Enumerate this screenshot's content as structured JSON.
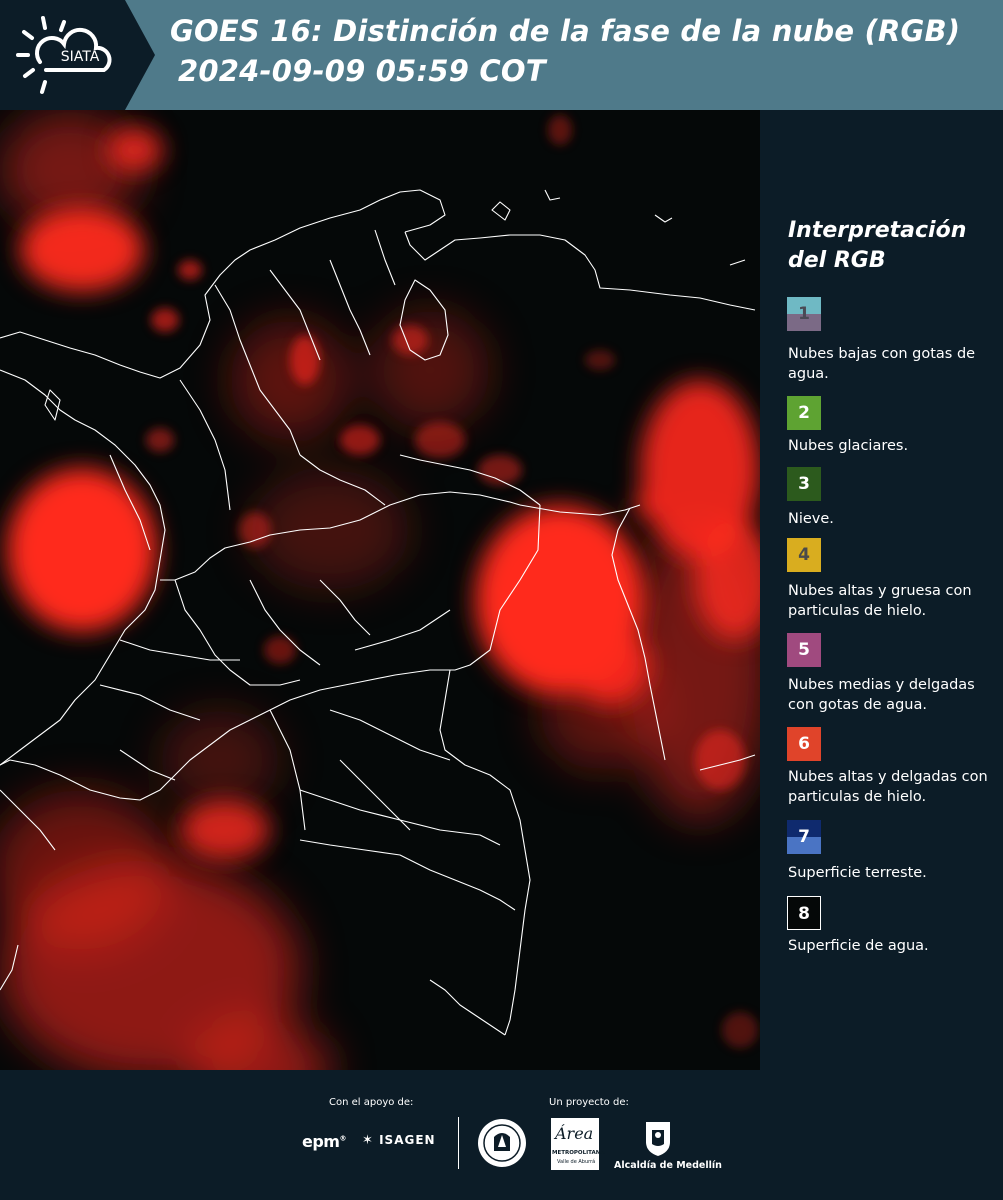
{
  "header": {
    "title_line1": "GOES 16: Distinción de la fase de la nube (RGB)",
    "title_line2": "2024-09-09 05:59 COT",
    "logo_text": "SIATA",
    "background_color": "#4f7a8a"
  },
  "legend": {
    "title": "Interpretación del RGB",
    "items": [
      {
        "number": "1",
        "label": "Nubes bajas con gotas de agua.",
        "color_top": "#6fb9c4",
        "color_bottom": "#7b6a86",
        "text_color": "#4a4a55"
      },
      {
        "number": "2",
        "label": "Nubes glaciares.",
        "color_top": "#5ea332",
        "color_bottom": "#5ea332",
        "text_color": "#ffffff"
      },
      {
        "number": "3",
        "label": "Nieve.",
        "color_top": "#2c5a1d",
        "color_bottom": "#2c5a1d",
        "text_color": "#ffffff"
      },
      {
        "number": "4",
        "label": "Nubes altas y gruesa con particulas de hielo.",
        "color_top": "#d9ad1f",
        "color_bottom": "#d9ad1f",
        "text_color": "#4a4a4a"
      },
      {
        "number": "5",
        "label": "Nubes medias y delgadas con gotas de agua.",
        "color_top": "#a04a7f",
        "color_bottom": "#a04a7f",
        "text_color": "#ffffff"
      },
      {
        "number": "6",
        "label": "Nubes altas y delgadas con particulas de hielo.",
        "color_top": "#e0442a",
        "color_bottom": "#e0442a",
        "text_color": "#ffffff"
      },
      {
        "number": "7",
        "label": "Superficie terreste.",
        "color_top": "#0f2a6e",
        "color_bottom": "#4a74c4",
        "text_color": "#ffffff"
      },
      {
        "number": "8",
        "label": "Superficie de agua.",
        "color_top": "#050808",
        "color_bottom": "#050808",
        "text_color": "#ffffff"
      }
    ]
  },
  "footer": {
    "support_label": "Con el apoyo de:",
    "project_label": "Un proyecto de:",
    "logo_epm": "epm",
    "logo_isagen": "ISAGEN",
    "logo_area_script": "Área",
    "logo_area_line1": "METROPOLITANA",
    "logo_area_line2": "Valle de Aburrá",
    "logo_alcaldia": "Alcaldía de Medellín"
  },
  "map": {
    "cloud_color": "#ff2a1e",
    "background_color": "#050808",
    "boundary_color": "#ffffff"
  }
}
